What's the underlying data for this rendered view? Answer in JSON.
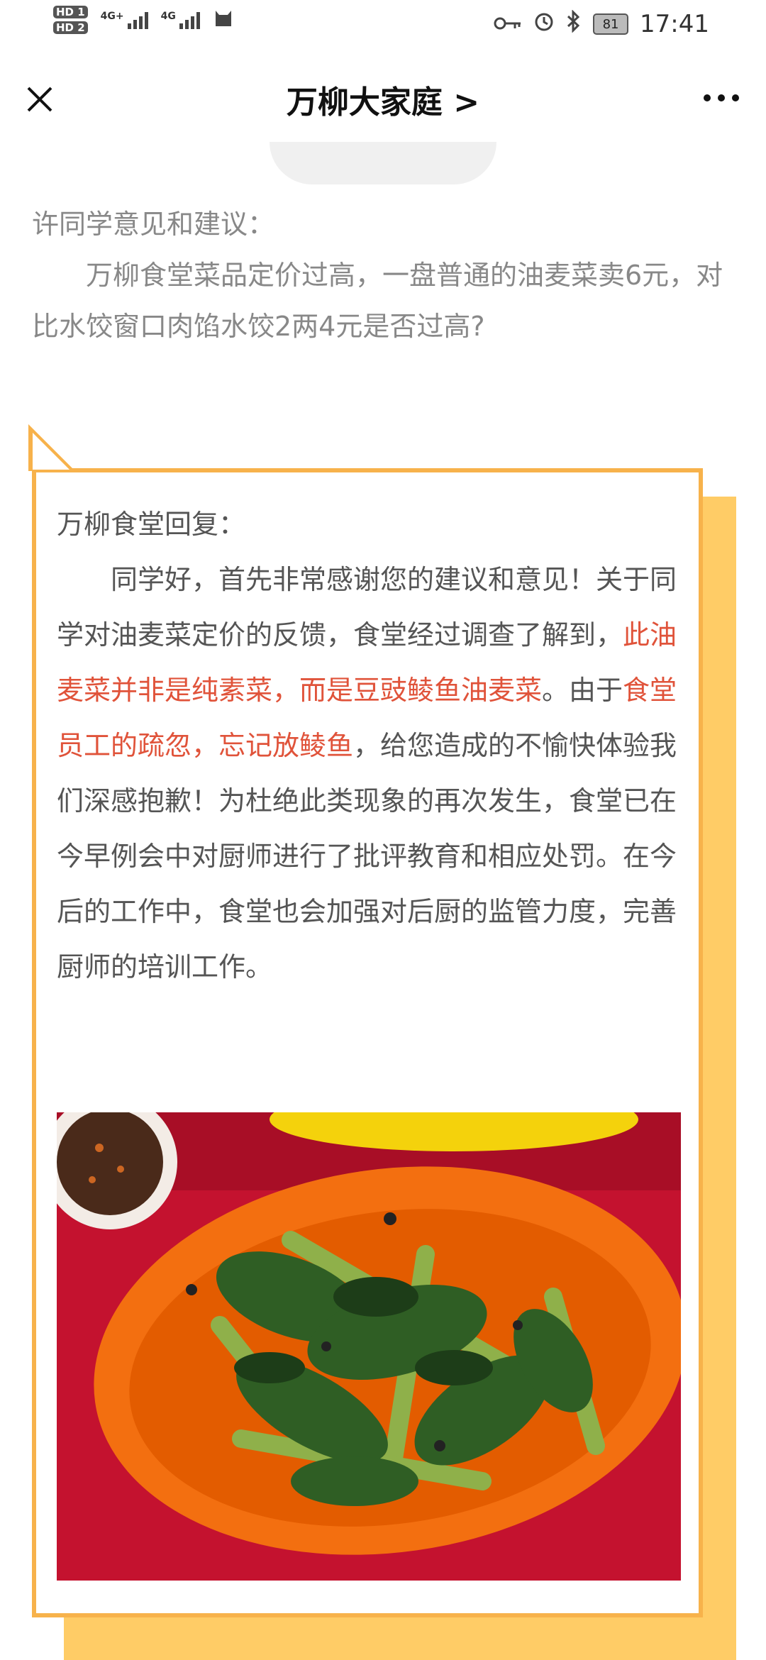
{
  "status_bar": {
    "hd1": "HD 1",
    "hd2": "HD 2",
    "net1": "4G+",
    "net2": "4G",
    "battery": "81",
    "time": "17:41"
  },
  "nav": {
    "title": "万柳大家庭 >",
    "close_glyph": "×",
    "more_glyph": "•••"
  },
  "question": {
    "heading": "许同学意见和建议：",
    "body": "万柳食堂菜品定价过高，一盘普通的油麦菜卖6元，对比水饺窗口肉馅水饺2两4元是否过高?"
  },
  "reply": {
    "heading": "万柳食堂回复：",
    "part1": "同学好，首先非常感谢您的建议和意见！关于同学对油麦菜定价的反馈，食堂经过调查了解到，",
    "highlight1": "此油麦菜并非是纯素菜，而是豆豉鲮鱼油麦菜",
    "part2": "。由于",
    "highlight2": "食堂员工的疏忽，忘记放鲮鱼",
    "part3": "，给您造成的不愉快体验我们深感抱歉！为杜绝此类现象的再次发生，食堂已在今早例会中对厨师进行了批评教育和相应处罚。在今后的工作中，食堂也会加强对后厨的监管力度，完善厨师的培训工作。"
  },
  "colors": {
    "accent_orange": "#f7b24b",
    "shadow_yellow": "#ffcc66",
    "highlight_red": "#e0533a",
    "text_gray": "#888888"
  },
  "icons": {
    "close": "close-icon",
    "more": "more-icon",
    "key": "key-icon",
    "alarm": "alarm-icon",
    "bluetooth": "bluetooth-icon",
    "cat": "cat-icon"
  }
}
